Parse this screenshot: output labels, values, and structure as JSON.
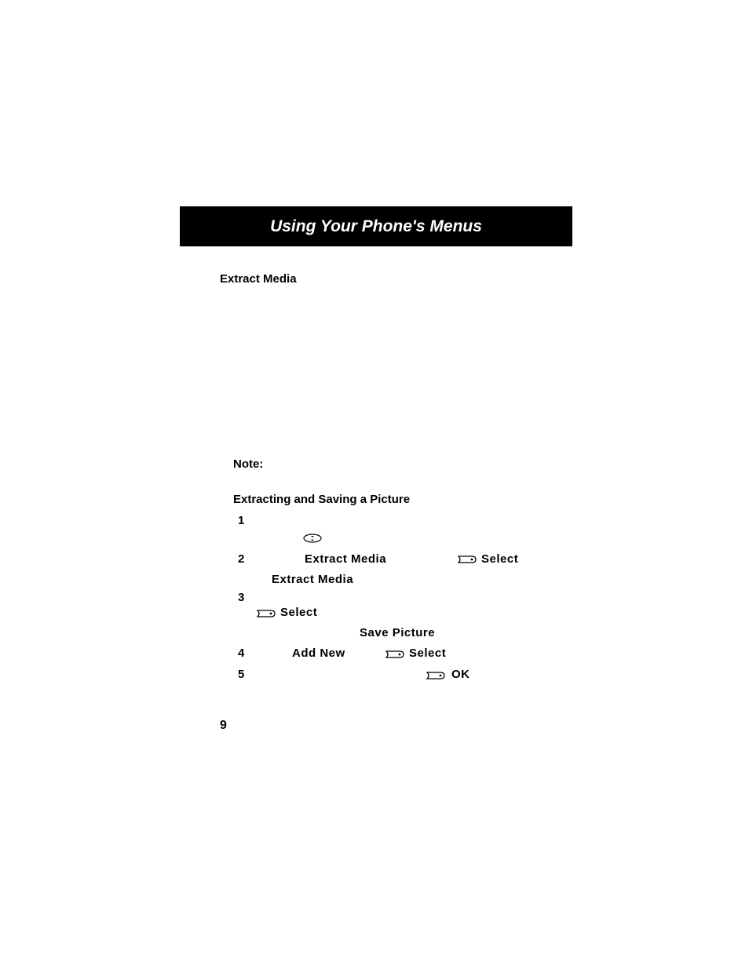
{
  "header": {
    "title": "Using Your Phone's Menus"
  },
  "sections": {
    "extractMediaHeading": "Extract Media",
    "noteLabel": "Note:",
    "extractSaveHeading": "Extracting and Saving a Picture"
  },
  "steps": {
    "s1": {
      "num": "1"
    },
    "s2": {
      "num": "2",
      "label1": "Extract Media",
      "action": "Select",
      "label2": "Extract Media"
    },
    "s3": {
      "num": "3",
      "action": "Select",
      "label2": "Save Picture"
    },
    "s4": {
      "num": "4",
      "label1": "Add New",
      "action": "Select"
    },
    "s5": {
      "num": "5",
      "action": "OK"
    }
  },
  "pageNumber": "9"
}
